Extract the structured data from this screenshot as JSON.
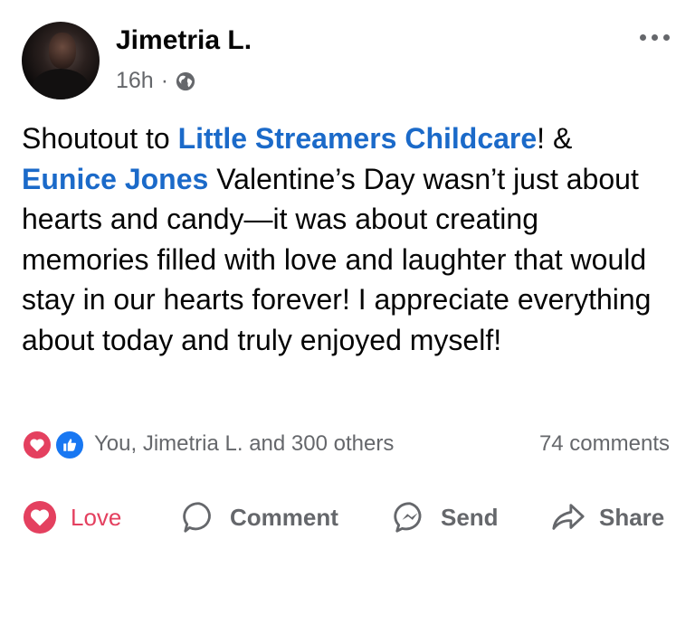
{
  "post": {
    "author": "Jimetria L.",
    "time": "16h",
    "separator": "·",
    "privacy_icon": "globe-icon",
    "text": {
      "t1": "Shoutout to ",
      "tag1": "Little Streamers Childcare",
      "t2": "! & ",
      "tag2": "Eunice Jones",
      "t3": " Valentine’s Day wasn’t just about hearts and candy—it was about creating memories filled with love and laughter that would stay in our hearts forever! I appreciate everything about today and truly enjoyed myself!"
    }
  },
  "reactions": {
    "icons": [
      "love-reaction-icon",
      "like-reaction-icon"
    ],
    "summary": "You, Jimetria L. and 300 others",
    "comments": "74 comments"
  },
  "actions": {
    "love": "Love",
    "comment": "Comment",
    "send": "Send",
    "share": "Share"
  },
  "colors": {
    "link": "#1b6ac9",
    "love": "#e4405f",
    "like": "#1877f2",
    "muted": "#65676b"
  }
}
